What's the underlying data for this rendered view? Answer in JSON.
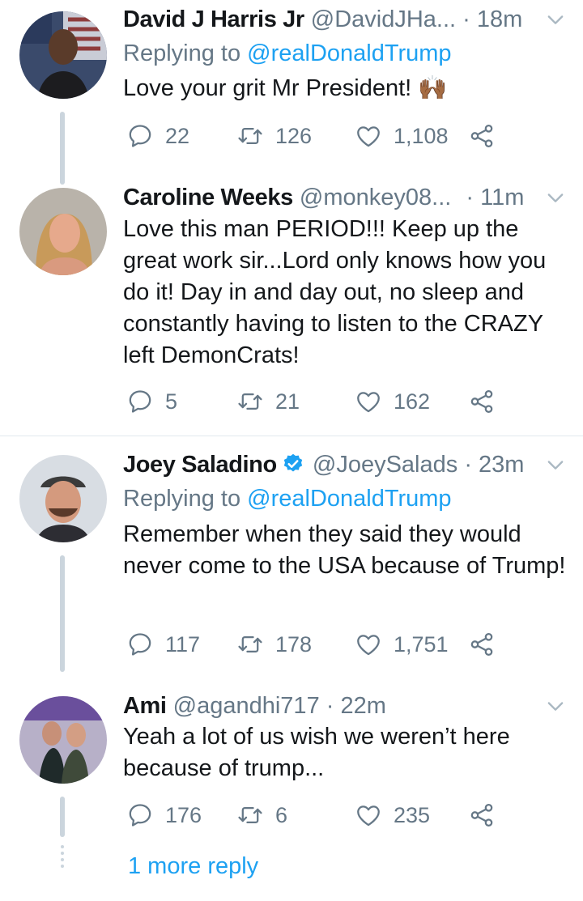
{
  "tweets": [
    {
      "name": "David J Harris Jr",
      "handle": "@DavidJHa...",
      "time": "· 18m",
      "replying_prefix": "Replying to",
      "replying_to": "@realDonaldTrump",
      "text": "Love your grit Mr President! 🙌🏾",
      "replies": "22",
      "retweets": "126",
      "likes": "1,108"
    },
    {
      "name": "Caroline Weeks",
      "handle": "@monkey08...",
      "time": "· 11m",
      "text": "Love this man PERIOD!!! Keep up the great work sir...Lord only knows how you do it! Day in and day out, no sleep and constantly having to listen to the CRAZY left DemonCrats!",
      "replies": "5",
      "retweets": "21",
      "likes": "162"
    },
    {
      "name": "Joey Saladino",
      "handle": "@JoeySalads",
      "time": "· 23m",
      "replying_prefix": "Replying to",
      "replying_to": "@realDonaldTrump",
      "text": "Remember when they said they would never come to the USA because of Trump!",
      "replies": "117",
      "retweets": "178",
      "likes": "1,751"
    },
    {
      "name": "Ami",
      "handle": "@agandhi717",
      "time": "· 22m",
      "text": "Yeah a lot of us wish we weren’t here because of trump...",
      "replies": "176",
      "retweets": "6",
      "likes": "235"
    }
  ],
  "more_replies": "1 more reply",
  "colors": {
    "accent": "#1da1f2",
    "secondary_text": "#657786",
    "thread_line": "#cbd5dd",
    "divider": "#e1e8ed",
    "verified": "#1da1f2"
  },
  "icons": [
    "reply-icon",
    "retweet-icon",
    "like-icon",
    "share-icon",
    "chevron-down-icon",
    "verified-badge-icon"
  ]
}
